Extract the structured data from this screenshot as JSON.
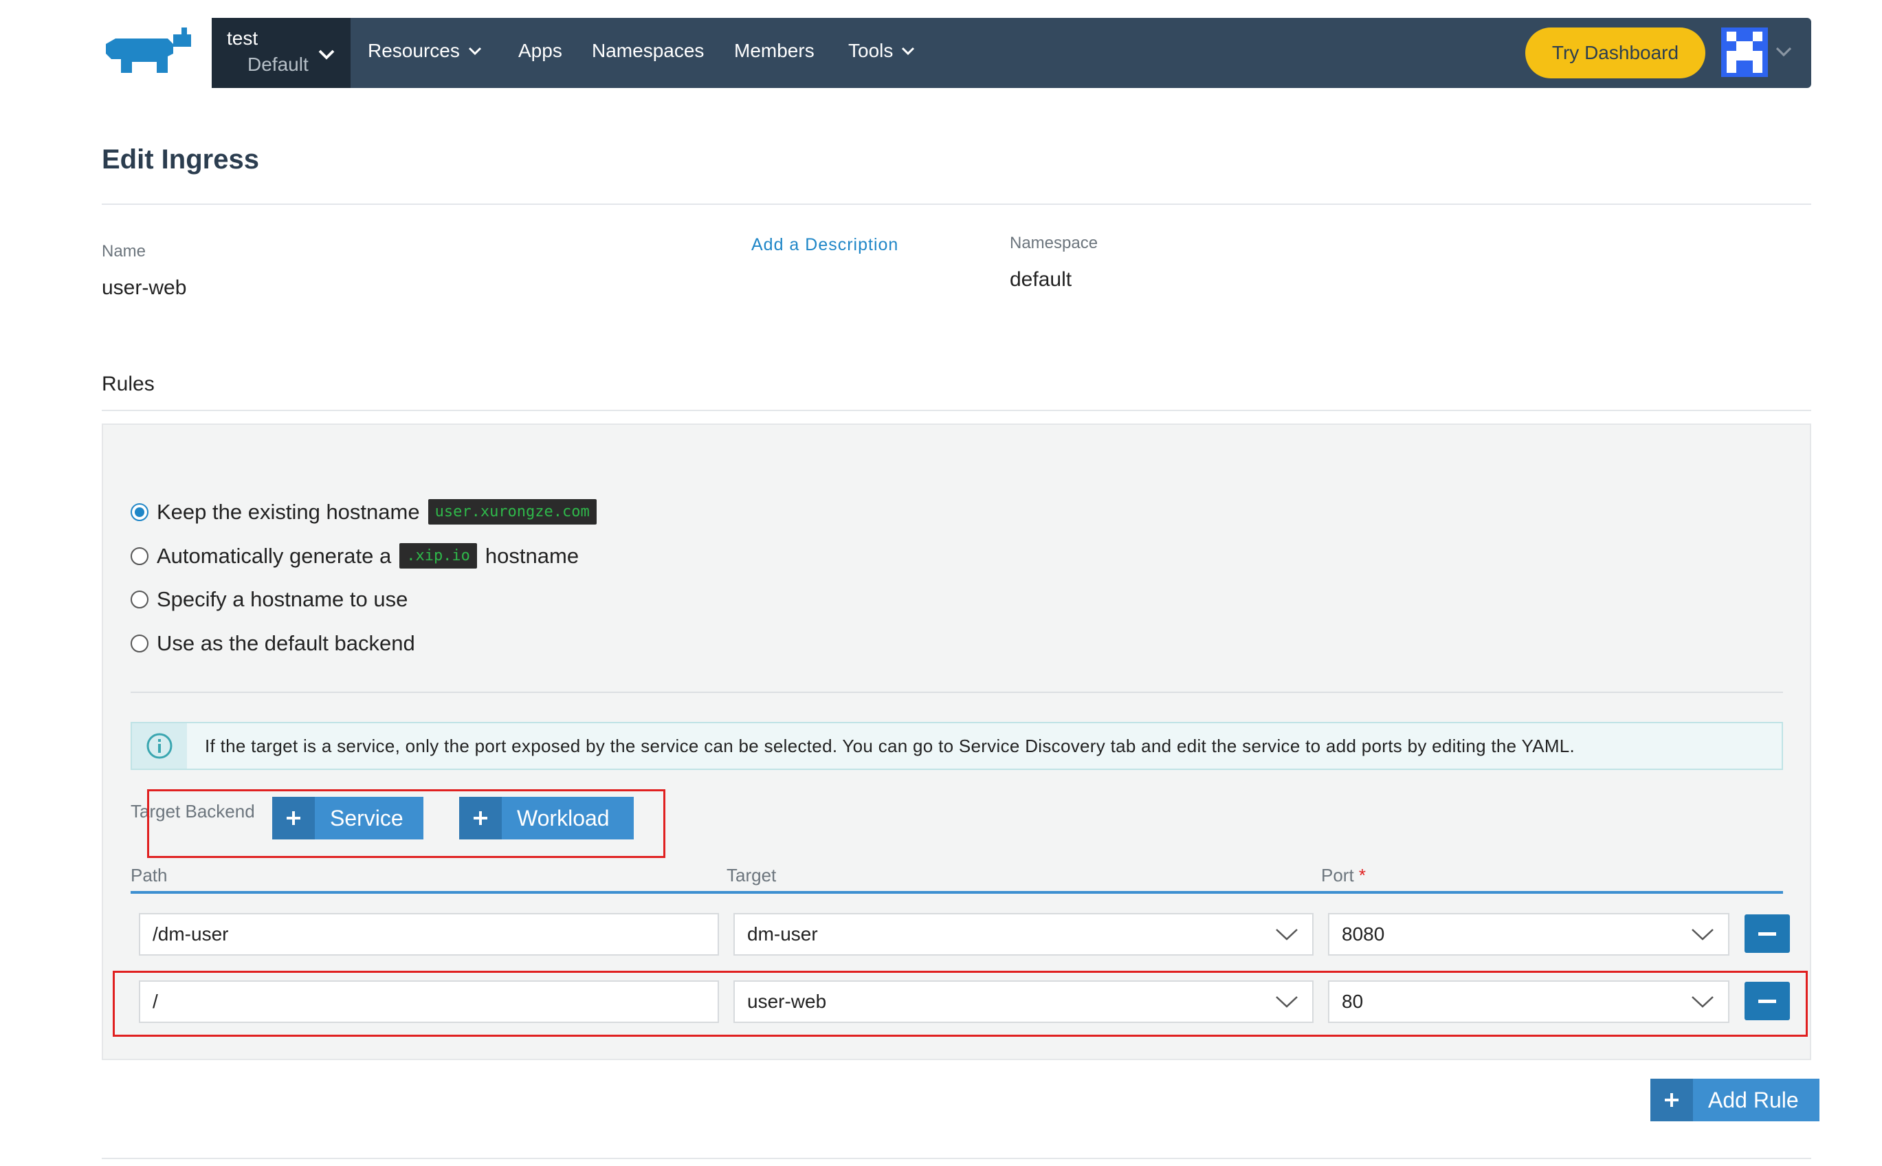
{
  "nav": {
    "cluster_name": "test",
    "project_name": "Default",
    "items": [
      {
        "label": "Resources",
        "dropdown": true
      },
      {
        "label": "Apps",
        "dropdown": false
      },
      {
        "label": "Namespaces",
        "dropdown": false
      },
      {
        "label": "Members",
        "dropdown": false
      },
      {
        "label": "Tools",
        "dropdown": true
      }
    ],
    "try_dashboard": "Try Dashboard",
    "colors": {
      "bar": "#34495e",
      "cluster_bg": "#1e2b38",
      "try_btn": "#f5c014",
      "logo": "#1f86c7"
    }
  },
  "page": {
    "title": "Edit Ingress",
    "name_label": "Name",
    "name_value": "user-web",
    "add_description": "Add a Description",
    "namespace_label": "Namespace",
    "namespace_value": "default"
  },
  "rules": {
    "title": "Rules",
    "hostname_options": {
      "keep_prefix": "Keep the existing hostname",
      "keep_code": "user.xurongze.com",
      "auto_prefix": "Automatically generate a",
      "auto_code": ".xip.io",
      "auto_suffix": "hostname",
      "specify": "Specify a hostname to use",
      "default_backend": "Use as the default backend",
      "selected": "keep"
    },
    "info_text": "If the target is a service, only the port exposed by the service can be selected. You can go to Service Discovery tab and edit the service to add ports by editing the YAML.",
    "target_backend_label": "Target Backend",
    "service_button": "Service",
    "workload_button": "Workload",
    "columns": {
      "path": "Path",
      "target": "Target",
      "port": "Port",
      "port_required": "*"
    },
    "rows": [
      {
        "path": "/dm-user",
        "target": "dm-user",
        "port": "8080"
      },
      {
        "path": "/",
        "target": "user-web",
        "port": "80"
      }
    ]
  },
  "add_rule_button": "Add Rule"
}
